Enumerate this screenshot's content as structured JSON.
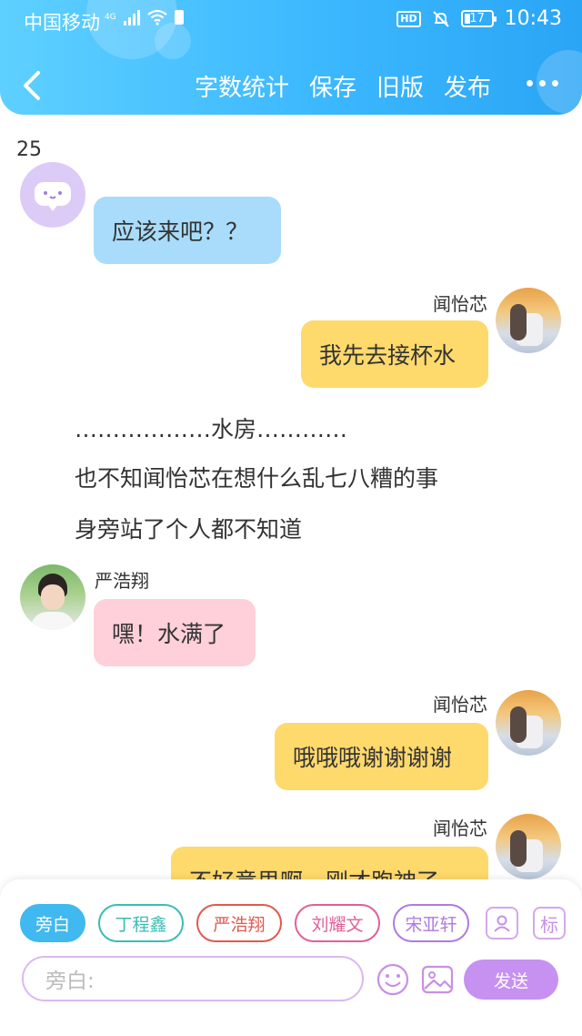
{
  "status_bar": {
    "carrier": "中国移动",
    "network": "4G",
    "time": "10:43",
    "hd_label": "HD",
    "battery": "17"
  },
  "header": {
    "actions": [
      "字数统计",
      "保存",
      "旧版",
      "发布"
    ]
  },
  "word_count": "25",
  "messages": [
    {
      "type": "left",
      "sender": "",
      "text": "应该来吧？？",
      "bubble_color": "#a8dcfa"
    },
    {
      "type": "right",
      "sender": "闻怡芯",
      "text": "我先去接杯水",
      "bubble_color": "#fed96c"
    },
    {
      "type": "narration",
      "text": "………………水房…………"
    },
    {
      "type": "narration",
      "text": "也不知闻怡芯在想什么乱七八糟的事"
    },
    {
      "type": "narration",
      "text": "身旁站了个人都不知道"
    },
    {
      "type": "left",
      "sender": "严浩翔",
      "text": "嘿！水满了",
      "bubble_color": "#ffd0da"
    },
    {
      "type": "right",
      "sender": "闻怡芯",
      "text": "哦哦哦谢谢谢谢",
      "bubble_color": "#fed96c"
    },
    {
      "type": "right",
      "sender": "闻怡芯",
      "text": "不好意思啊，刚才跑神了",
      "bubble_color": "#fed96c"
    }
  ],
  "roles": [
    {
      "label": "旁白",
      "active": true,
      "color": "#40b8f0"
    },
    {
      "label": "丁程鑫",
      "active": false,
      "color": "#3cbcb4"
    },
    {
      "label": "严浩翔",
      "active": false,
      "color": "#e05a50"
    },
    {
      "label": "刘耀文",
      "active": false,
      "color": "#e0609a"
    },
    {
      "label": "宋亚轩",
      "active": false,
      "color": "#b07ae0"
    }
  ],
  "toolbar": {
    "tag_label": "标",
    "input_placeholder": "旁白:",
    "send_label": "发送"
  }
}
